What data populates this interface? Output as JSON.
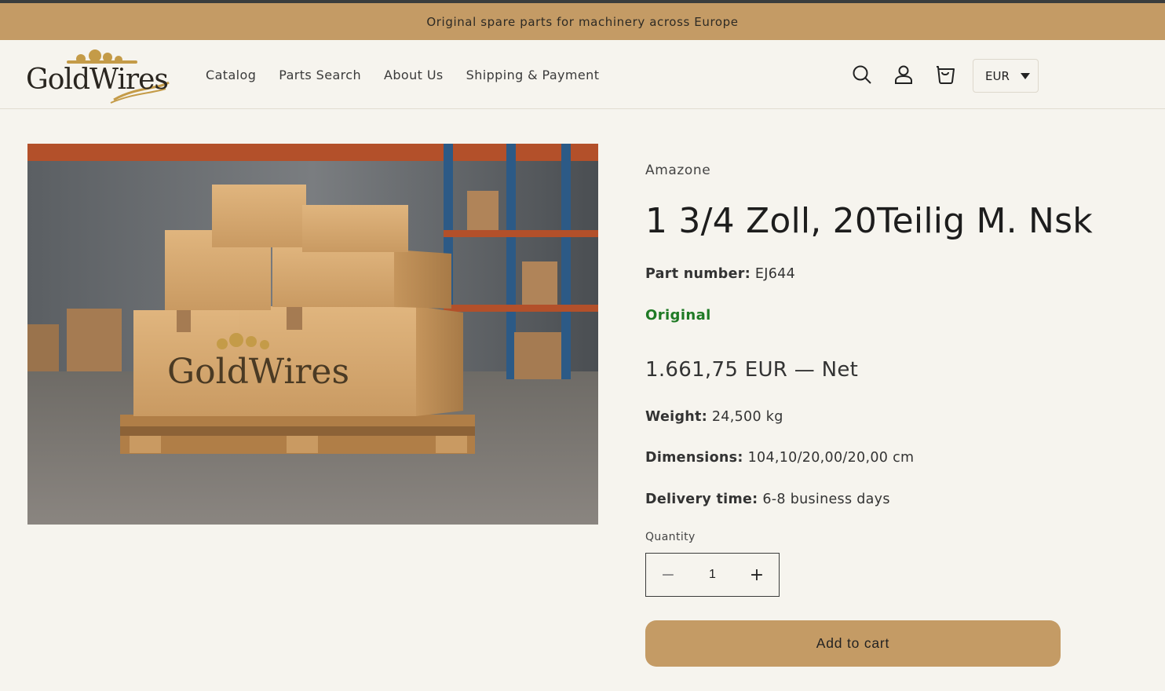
{
  "announcement": "Original spare parts for machinery across Europe",
  "header": {
    "logo_text": "GoldWires",
    "nav": [
      "Catalog",
      "Parts Search",
      "About Us",
      "Shipping & Payment"
    ],
    "currency": "EUR",
    "icons": [
      "search-icon",
      "account-icon",
      "cart-icon"
    ]
  },
  "product": {
    "image_caption_text": "GoldWires",
    "vendor": "Amazone",
    "title": "1 3/4 Zoll, 20Teilig M. Nsk",
    "part_number_label": "Part number:",
    "part_number": "EJ644",
    "condition": "Original",
    "price": "1.661,75 EUR — Net",
    "weight_label": "Weight:",
    "weight": "24,500 kg",
    "dimensions_label": "Dimensions:",
    "dimensions": "104,10/20,00/20,00 cm",
    "delivery_label": "Delivery time:",
    "delivery": "6-8 business days",
    "quantity_label": "Quantity",
    "quantity": "1",
    "minus": "−",
    "plus": "+",
    "add_to_cart": "Add to cart"
  },
  "colors": {
    "accent": "#c49b65",
    "background": "#f6f4ee",
    "original_green": "#1f7a25"
  }
}
